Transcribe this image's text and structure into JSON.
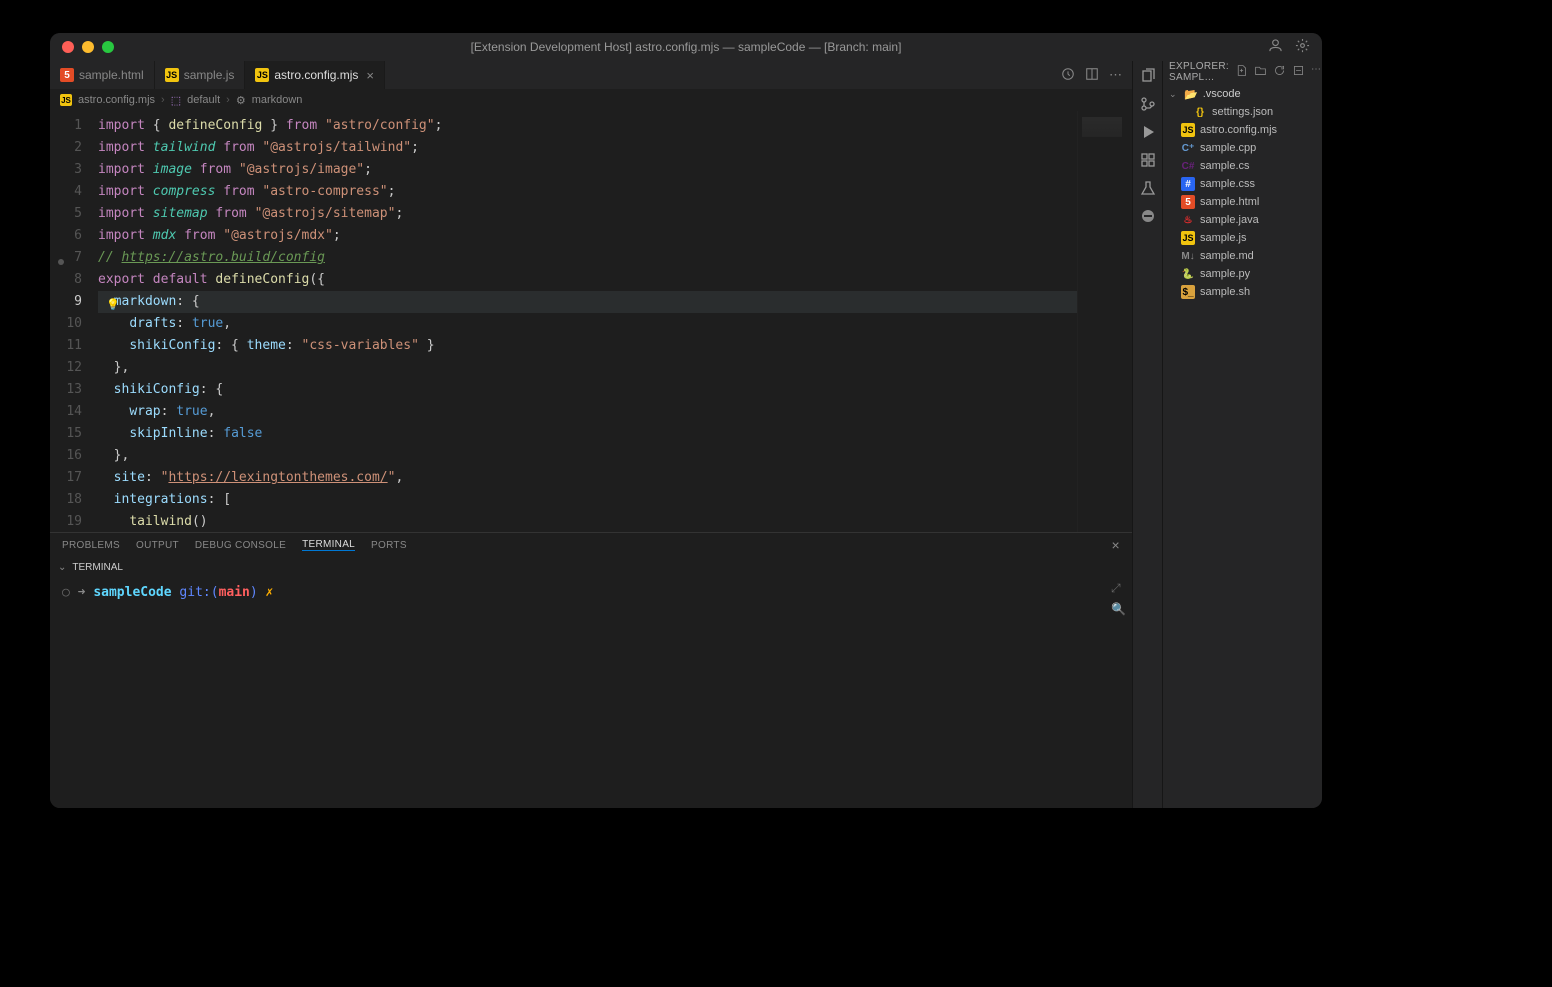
{
  "titlebar": {
    "title": "[Extension Development Host] astro.config.mjs — sampleCode — [Branch: main]"
  },
  "tabs": [
    {
      "icon": "html",
      "label": "sample.html",
      "active": false,
      "dirty": false
    },
    {
      "icon": "js",
      "label": "sample.js",
      "active": false,
      "dirty": false
    },
    {
      "icon": "js",
      "label": "astro.config.mjs",
      "active": true,
      "dirty": false
    }
  ],
  "breadcrumb": {
    "file": "astro.config.mjs",
    "symbol1": "default",
    "symbol2": "markdown"
  },
  "code_lines": [
    {
      "n": 1,
      "html": "<span class='k'>import</span> <span class='pl'>{ </span><span class='f'>defineConfig</span><span class='pl'> }</span> <span class='k'>from</span> <span class='s'>\"astro/config\"</span><span class='pl'>;</span>"
    },
    {
      "n": 2,
      "html": "<span class='k'>import</span> <span class='n'><i>tailwind</i></span> <span class='k'>from</span> <span class='s'>\"@astrojs/tailwind\"</span><span class='pl'>;</span>"
    },
    {
      "n": 3,
      "html": "<span class='k'>import</span> <span class='n'><i>image</i></span> <span class='k'>from</span> <span class='s'>\"@astrojs/image\"</span><span class='pl'>;</span>"
    },
    {
      "n": 4,
      "html": "<span class='k'>import</span> <span class='n'><i>compress</i></span> <span class='k'>from</span> <span class='s'>\"astro-compress\"</span><span class='pl'>;</span>"
    },
    {
      "n": 5,
      "html": "<span class='k'>import</span> <span class='n'><i>sitemap</i></span> <span class='k'>from</span> <span class='s'>\"@astrojs/sitemap\"</span><span class='pl'>;</span>"
    },
    {
      "n": 6,
      "html": "<span class='k'>import</span> <span class='n'><i>mdx</i></span> <span class='k'>from</span> <span class='s'>\"@astrojs/mdx\"</span><span class='pl'>;</span>"
    },
    {
      "n": 7,
      "html": "<span class='c'>// <u>https://astro.build/config</u></span>"
    },
    {
      "n": 8,
      "html": "<span class='k'>export</span> <span class='k'>default</span> <span class='f'>defineConfig</span><span class='pl'>({</span>"
    },
    {
      "n": 9,
      "hl": true,
      "html": "  <span class='p'>markdown</span><span class='pl'>: {</span>"
    },
    {
      "n": 10,
      "html": "    <span class='p'>drafts</span><span class='pl'>: </span><span class='b'>true</span><span class='pl'>,</span>"
    },
    {
      "n": 11,
      "html": "    <span class='p'>shikiConfig</span><span class='pl'>: { </span><span class='p'>theme</span><span class='pl'>: </span><span class='s'>\"css-variables\"</span><span class='pl'> }</span>"
    },
    {
      "n": 12,
      "html": "  <span class='pl'>},</span>"
    },
    {
      "n": 13,
      "html": "  <span class='p'>shikiConfig</span><span class='pl'>: {</span>"
    },
    {
      "n": 14,
      "html": "    <span class='p'>wrap</span><span class='pl'>: </span><span class='b'>true</span><span class='pl'>,</span>"
    },
    {
      "n": 15,
      "html": "    <span class='p'>skipInline</span><span class='pl'>: </span><span class='b'>false</span>"
    },
    {
      "n": 16,
      "html": "  <span class='pl'>},</span>"
    },
    {
      "n": 17,
      "html": "  <span class='p'>site</span><span class='pl'>: </span><span class='s'>\"<u>https://lexingtonthemes.com/</u>\"</span><span class='pl'>,</span>"
    },
    {
      "n": 18,
      "html": "  <span class='p'>integrations</span><span class='pl'>: [</span>"
    },
    {
      "n": 19,
      "html": "    <span class='f'>tailwind</span><span class='pl'>()</span>"
    }
  ],
  "current_line": 9,
  "panel": {
    "tabs": [
      "PROBLEMS",
      "OUTPUT",
      "DEBUG CONSOLE",
      "TERMINAL",
      "PORTS"
    ],
    "active": "TERMINAL",
    "header": "TERMINAL",
    "prompt": {
      "arrow": "➜",
      "dir": "sampleCode",
      "git": "git:(",
      "branch": "main",
      "gitend": ")",
      "dirty": "✗"
    }
  },
  "explorer": {
    "title": "EXPLORER: SAMPL…",
    "folder": {
      "name": ".vscode",
      "open": true
    },
    "folder_children": [
      {
        "icon": "json",
        "name": "settings.json"
      }
    ],
    "files": [
      {
        "icon": "js",
        "name": "astro.config.mjs"
      },
      {
        "icon": "cpp",
        "name": "sample.cpp"
      },
      {
        "icon": "cs",
        "name": "sample.cs"
      },
      {
        "icon": "css",
        "name": "sample.css"
      },
      {
        "icon": "html",
        "name": "sample.html"
      },
      {
        "icon": "java",
        "name": "sample.java"
      },
      {
        "icon": "js",
        "name": "sample.js"
      },
      {
        "icon": "md",
        "name": "sample.md"
      },
      {
        "icon": "py",
        "name": "sample.py"
      },
      {
        "icon": "sh",
        "name": "sample.sh"
      }
    ]
  }
}
